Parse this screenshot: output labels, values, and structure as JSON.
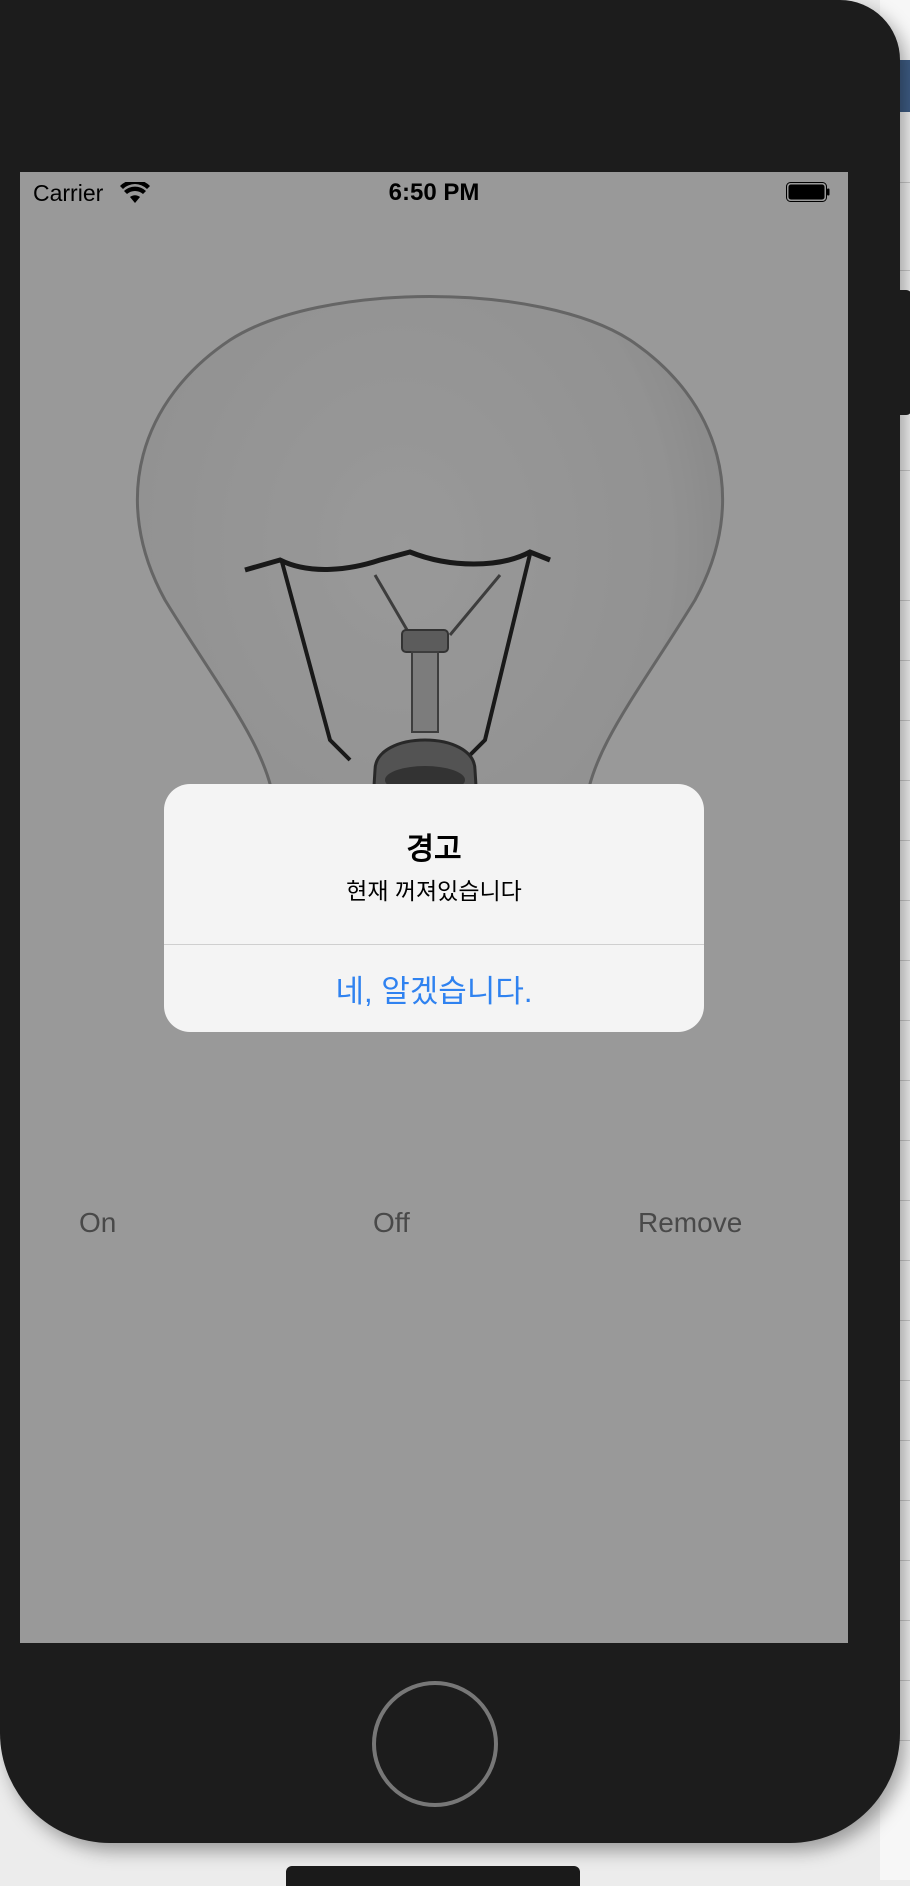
{
  "status_bar": {
    "carrier": "Carrier",
    "time": "6:50 PM",
    "wifi_icon": "wifi-icon",
    "battery_icon": "battery-icon"
  },
  "controls": {
    "on_label": "On",
    "off_label": "Off",
    "remove_label": "Remove"
  },
  "alert": {
    "title": "경고",
    "message": "현재 꺼져있습니다",
    "confirm_label": "네, 알겠습니다."
  },
  "colors": {
    "accent": "#2f82f0",
    "phone_frame": "#1c1c1c",
    "alert_background": "#f4f4f4"
  }
}
